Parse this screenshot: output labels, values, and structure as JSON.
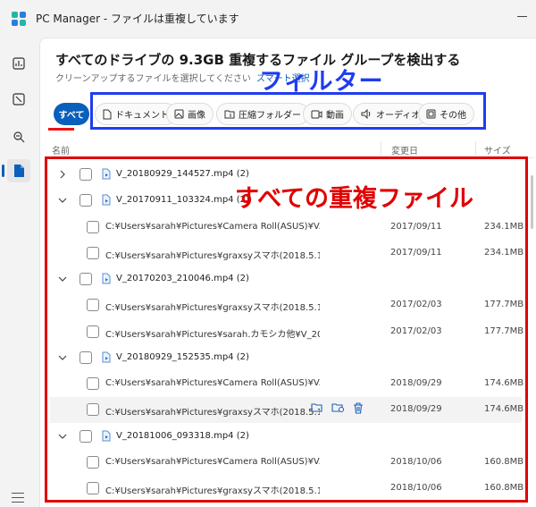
{
  "window": {
    "title": "PC Manager - ファイルは重複しています"
  },
  "header": {
    "title": "すべてのドライブの 9.3GB 重複するファイル グループを検出する",
    "subtitle": "クリーンアップするファイルを選択してください",
    "smart_select": "スマート選択"
  },
  "annotations": {
    "filter": "フィルター",
    "all_duplicates": "すべての重複ファイル"
  },
  "filters": {
    "all": "すべて",
    "items": [
      {
        "label": "ドキュメント",
        "icon": "document-icon"
      },
      {
        "label": "画像",
        "icon": "image-icon"
      },
      {
        "label": "圧縮フォルダー",
        "icon": "zip-folder-icon"
      },
      {
        "label": "動画",
        "icon": "video-icon"
      },
      {
        "label": "オーディオ",
        "icon": "audio-icon"
      },
      {
        "label": "その他",
        "icon": "other-icon"
      }
    ]
  },
  "columns": {
    "name": "名前",
    "modified": "変更日",
    "size": "サイズ"
  },
  "groups": [
    {
      "name": "V_20180929_144527.mp4 (2)",
      "expanded": false,
      "files": []
    },
    {
      "name": "V_20170911_103324.mp4 (2)",
      "expanded": true,
      "files": [
        {
          "path": "C:¥Users¥sarah¥Pictures¥Camera Roll(ASUS)¥V...",
          "date": "2017/09/11",
          "size": "234.1MB"
        },
        {
          "path": "C:¥Users¥sarah¥Pictures¥graxsyスマホ(2018.5.1...",
          "date": "2017/09/11",
          "size": "234.1MB"
        }
      ]
    },
    {
      "name": "V_20170203_210046.mp4 (2)",
      "expanded": true,
      "files": [
        {
          "path": "C:¥Users¥sarah¥Pictures¥graxsyスマホ(2018.5.1...",
          "date": "2017/02/03",
          "size": "177.7MB"
        },
        {
          "path": "C:¥Users¥sarah¥Pictures¥sarah.カモシカ他¥V_20...",
          "date": "2017/02/03",
          "size": "177.7MB"
        }
      ]
    },
    {
      "name": "V_20180929_152535.mp4 (2)",
      "expanded": true,
      "files": [
        {
          "path": "C:¥Users¥sarah¥Pictures¥Camera Roll(ASUS)¥V...",
          "date": "2018/09/29",
          "size": "174.6MB"
        },
        {
          "path": "C:¥Users¥sarah¥Pictures¥graxsyスマホ(2018.5.1...",
          "date": "2018/09/29",
          "size": "174.6MB",
          "hover": true
        }
      ]
    },
    {
      "name": "V_20181006_093318.mp4 (2)",
      "expanded": true,
      "files": [
        {
          "path": "C:¥Users¥sarah¥Pictures¥Camera Roll(ASUS)¥V...",
          "date": "2018/10/06",
          "size": "160.8MB"
        },
        {
          "path": "C:¥Users¥sarah¥Pictures¥graxsyスマホ(2018.5.1...",
          "date": "2018/10/06",
          "size": "160.8MB"
        }
      ]
    }
  ],
  "colors": {
    "accent": "#0a5fbd",
    "annotation_blue": "#1f3cf0",
    "annotation_red": "#e00000"
  }
}
